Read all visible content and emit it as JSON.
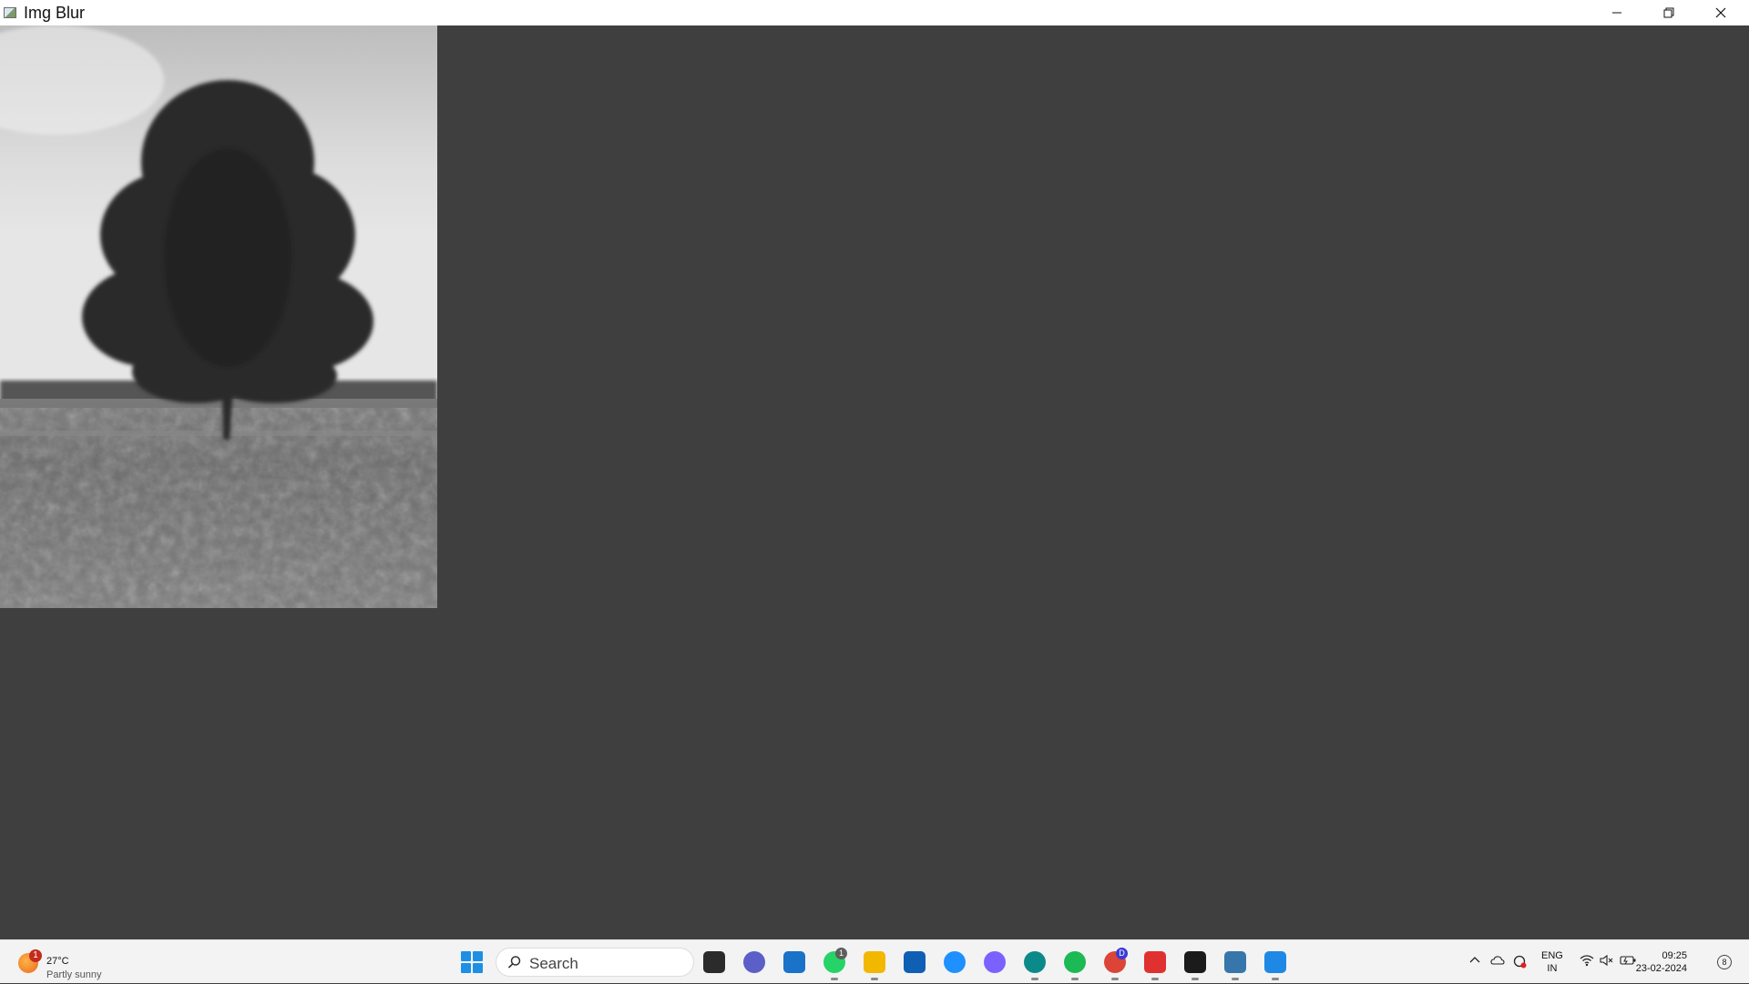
{
  "window": {
    "title": "Img Blur",
    "minimize_icon": "minimize-icon",
    "maximize_icon": "restore-icon",
    "close_icon": "close-icon"
  },
  "image": {
    "description_icon": "tree-photo",
    "style": "grayscale-blurred"
  },
  "taskbar": {
    "weather": {
      "temp": "27°C",
      "desc": "Partly sunny",
      "badge": "1"
    },
    "search": {
      "placeholder": "Search"
    },
    "apps": [
      {
        "name": "file-manager-icon",
        "color": "#2b2b2b",
        "active": false,
        "badge": ""
      },
      {
        "name": "teams-icon",
        "color": "#5b5fc7",
        "active": false,
        "badge": ""
      },
      {
        "name": "app-window-icon",
        "color": "#1a73c9",
        "active": false,
        "badge": ""
      },
      {
        "name": "whatsapp-icon",
        "color": "#25d366",
        "active": true,
        "badge": "1"
      },
      {
        "name": "explorer-folder-icon",
        "color": "#f2b800",
        "active": true,
        "badge": ""
      },
      {
        "name": "store-icon",
        "color": "#0f5fb5",
        "active": false,
        "badge": ""
      },
      {
        "name": "help-icon",
        "color": "#1e90ff",
        "active": false,
        "badge": ""
      },
      {
        "name": "copilot-icon",
        "color": "#7b61ff",
        "active": false,
        "badge": ""
      },
      {
        "name": "edge-icon",
        "color": "#0c8a8a",
        "active": true,
        "badge": ""
      },
      {
        "name": "spotify-icon",
        "color": "#1db954",
        "active": true,
        "badge": ""
      },
      {
        "name": "chrome-icon",
        "color": "#db4437",
        "active": true,
        "badge": "D"
      },
      {
        "name": "pen-app-icon",
        "color": "#e03131",
        "active": true,
        "badge": ""
      },
      {
        "name": "terminal-icon",
        "color": "#1b1b1b",
        "active": true,
        "badge": ""
      },
      {
        "name": "python-icon",
        "color": "#3776ab",
        "active": true,
        "badge": ""
      },
      {
        "name": "photo-app-icon",
        "color": "#1e88e5",
        "active": true,
        "badge": ""
      }
    ],
    "tray": {
      "lang_line1": "ENG",
      "lang_line2": "IN",
      "time": "09:25",
      "date": "23-02-2024",
      "notifications": "8"
    }
  }
}
